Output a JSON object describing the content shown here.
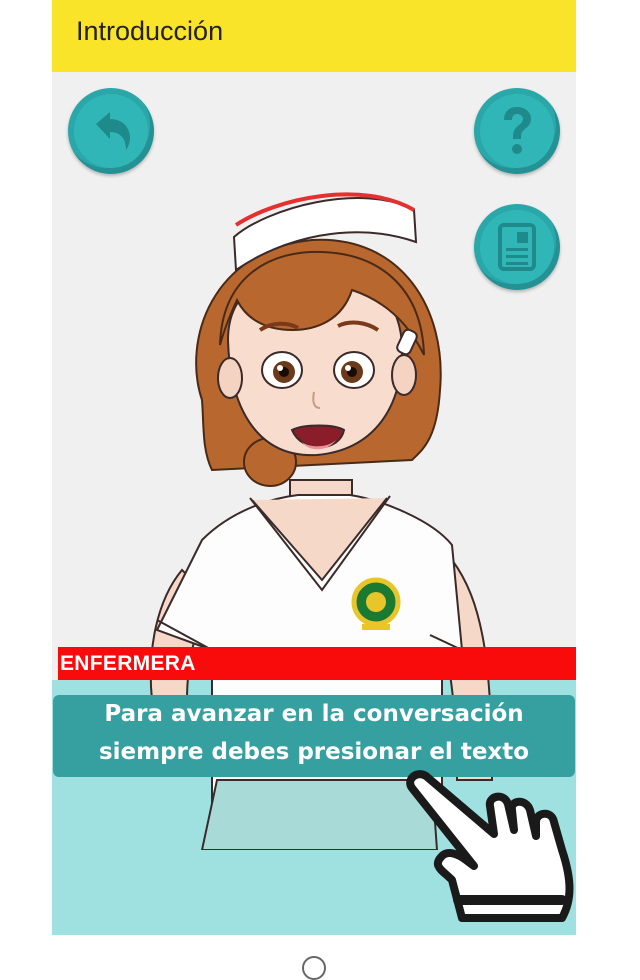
{
  "header": {
    "title": "Introducción"
  },
  "buttons": {
    "back_icon": "back-arrow-icon",
    "help_icon": "question-icon",
    "notes_icon": "document-icon"
  },
  "character": {
    "name": "ENFERMERA"
  },
  "dialog": {
    "line1": "Para avanzar en la conversación",
    "line2": "siempre debes presionar el texto"
  },
  "colors": {
    "header": "#fae42a",
    "button": "#2aa7a9",
    "name_bar": "#fa0b0b",
    "dialog_bg": "#36a0a0",
    "bottom_bg": "#9ee1e0"
  }
}
